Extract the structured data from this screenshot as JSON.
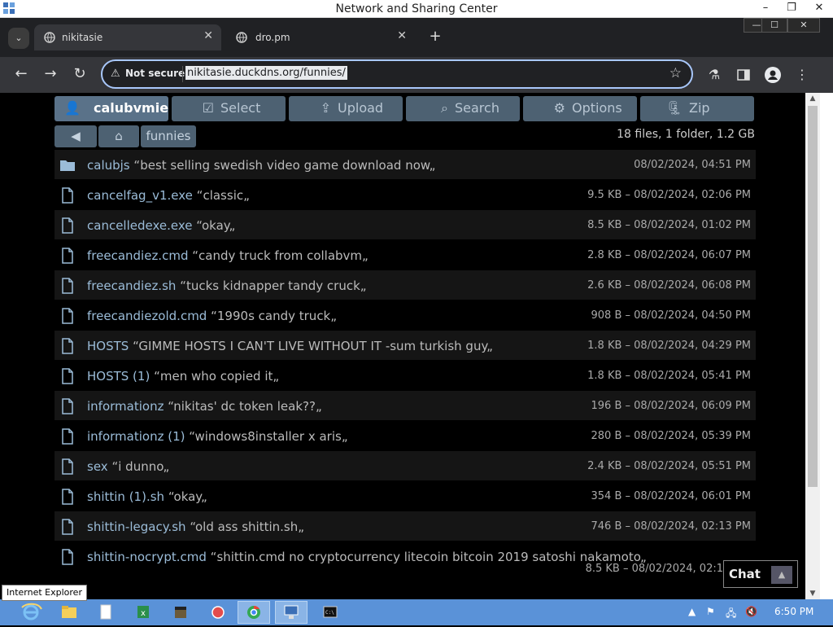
{
  "window": {
    "title": "Network and Sharing Center",
    "minimize": "–",
    "restore": "❐",
    "close": "✕"
  },
  "browser": {
    "tab_menu": "⌄",
    "tabs": [
      {
        "label": "nikitasie",
        "close": "✕"
      },
      {
        "label": "dro.pm",
        "close": "✕"
      }
    ],
    "new_tab": "+",
    "chrome_controls": {
      "minimize": "—",
      "maximize": "☐",
      "close": "✕"
    },
    "nav": {
      "back": "←",
      "forward": "→",
      "reload": "↻"
    },
    "security_label": "Not secure",
    "url": "nikitasie.duckdns.org/funnies/"
  },
  "file_browser": {
    "ops": [
      {
        "icon": "user-icon",
        "label": "calubvmie"
      },
      {
        "icon": "select-icon",
        "label": "Select"
      },
      {
        "icon": "upload-icon",
        "label": "Upload"
      },
      {
        "icon": "search-icon",
        "label": "Search"
      },
      {
        "icon": "gear-icon",
        "label": "Options"
      },
      {
        "icon": "zip-icon",
        "label": "Zip"
      }
    ],
    "breadcrumb": {
      "current": "funnies"
    },
    "summary": "18 files, 1 folder, 1.2 GB",
    "open_quote": "“",
    "close_quote": "„",
    "rows": [
      {
        "type": "folder",
        "name": "calubjs",
        "desc": "best selling swedish video game download now",
        "meta": "08/02/2024, 04:51 PM"
      },
      {
        "type": "file",
        "name": "cancelfag_v1.exe",
        "desc": "classic",
        "meta": "9.5 KB – 08/02/2024, 02:06 PM"
      },
      {
        "type": "file",
        "name": "cancelledexe.exe",
        "desc": "okay",
        "meta": "8.5 KB – 08/02/2024, 01:02 PM"
      },
      {
        "type": "file",
        "name": "freecandiez.cmd",
        "desc": "candy truck from collabvm",
        "meta": "2.8 KB – 08/02/2024, 06:07 PM"
      },
      {
        "type": "file",
        "name": "freecandiez.sh",
        "desc": "tucks kidnapper tandy cruck",
        "meta": "2.6 KB – 08/02/2024, 06:08 PM"
      },
      {
        "type": "file",
        "name": "freecandiezold.cmd",
        "desc": "1990s candy truck",
        "meta": "908 B – 08/02/2024, 04:50 PM"
      },
      {
        "type": "file",
        "name": "HOSTS",
        "desc": "GIMME HOSTS I CAN'T LIVE WITHOUT IT -sum turkish guy",
        "meta": "1.8 KB – 08/02/2024, 04:29 PM"
      },
      {
        "type": "file",
        "name": "HOSTS (1)",
        "desc": "men who copied it",
        "meta": "1.8 KB – 08/02/2024, 05:41 PM"
      },
      {
        "type": "file",
        "name": "informationz",
        "desc": "nikitas' dc token leak??",
        "meta": "196 B – 08/02/2024, 06:09 PM"
      },
      {
        "type": "file",
        "name": "informationz (1)",
        "desc": "windows8installer x aris",
        "meta": "280 B – 08/02/2024, 05:39 PM"
      },
      {
        "type": "file",
        "name": "sex",
        "desc": "i dunno",
        "meta": "2.4 KB – 08/02/2024, 05:51 PM"
      },
      {
        "type": "file",
        "name": "shittin (1).sh",
        "desc": "okay",
        "meta": "354 B – 08/02/2024, 06:01 PM"
      },
      {
        "type": "file",
        "name": "shittin-legacy.sh",
        "desc": "old ass shittin.sh",
        "meta": "746 B – 08/02/2024, 02:13 PM"
      },
      {
        "type": "file",
        "name": "shittin-nocrypt.cmd",
        "desc": "shittin.cmd no cryptocurrency litecoin bitcoin 2019 satoshi nakamoto",
        "meta": "8.5 KB – 08/02/2024, 02:1"
      }
    ],
    "chat": {
      "label": "Chat",
      "button": "▲"
    }
  },
  "tooltip": "Internet Explorer",
  "taskbar": {
    "items": [
      "ie-icon",
      "explorer-icon",
      "notepad-icon",
      "excel-icon",
      "package-icon",
      "app-red-icon",
      "chrome-icon",
      "network-icon",
      "cmd-icon"
    ],
    "clock": "6:50 PM"
  },
  "colors": {
    "accent": "#a8c7fa",
    "button_bg": "#4d6172",
    "link": "#9bbcd8",
    "taskbar": "#5a92d8"
  }
}
